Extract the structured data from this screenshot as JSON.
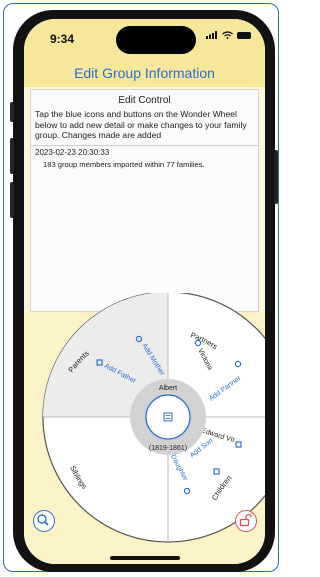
{
  "status": {
    "time": "9:34"
  },
  "nav": {
    "title": "Edit Group Information"
  },
  "edit_control": {
    "title": "Edit Control",
    "description": "Tap the blue icons and buttons on the Wonder Wheel below to add new detail or make changes to your family group. Changes made are added",
    "timestamp": "2023-02-23 20:30:33",
    "log_line": "183 group members imported within 77 families."
  },
  "wheel": {
    "center_name": "Albert",
    "center_dates": "(1819-1861)",
    "sections": {
      "parents": "Parents",
      "partners": "Partners",
      "children": "Children",
      "siblings": "Siblings"
    },
    "parents": {
      "add_mother": "Add Mother",
      "add_father": "Add Father"
    },
    "partners": {
      "name": "Victoria",
      "add_partner": "Add Partner"
    },
    "children": {
      "name": "Edward VII",
      "add_son": "Add Son",
      "add_daughter": "Add Daughter"
    }
  },
  "colors": {
    "accent": "#2e6fd1",
    "header": "#f6e79b",
    "lock": "#d9534f"
  },
  "icons": {
    "search": "magnifier",
    "lock": "padlock-open",
    "center": "card"
  }
}
